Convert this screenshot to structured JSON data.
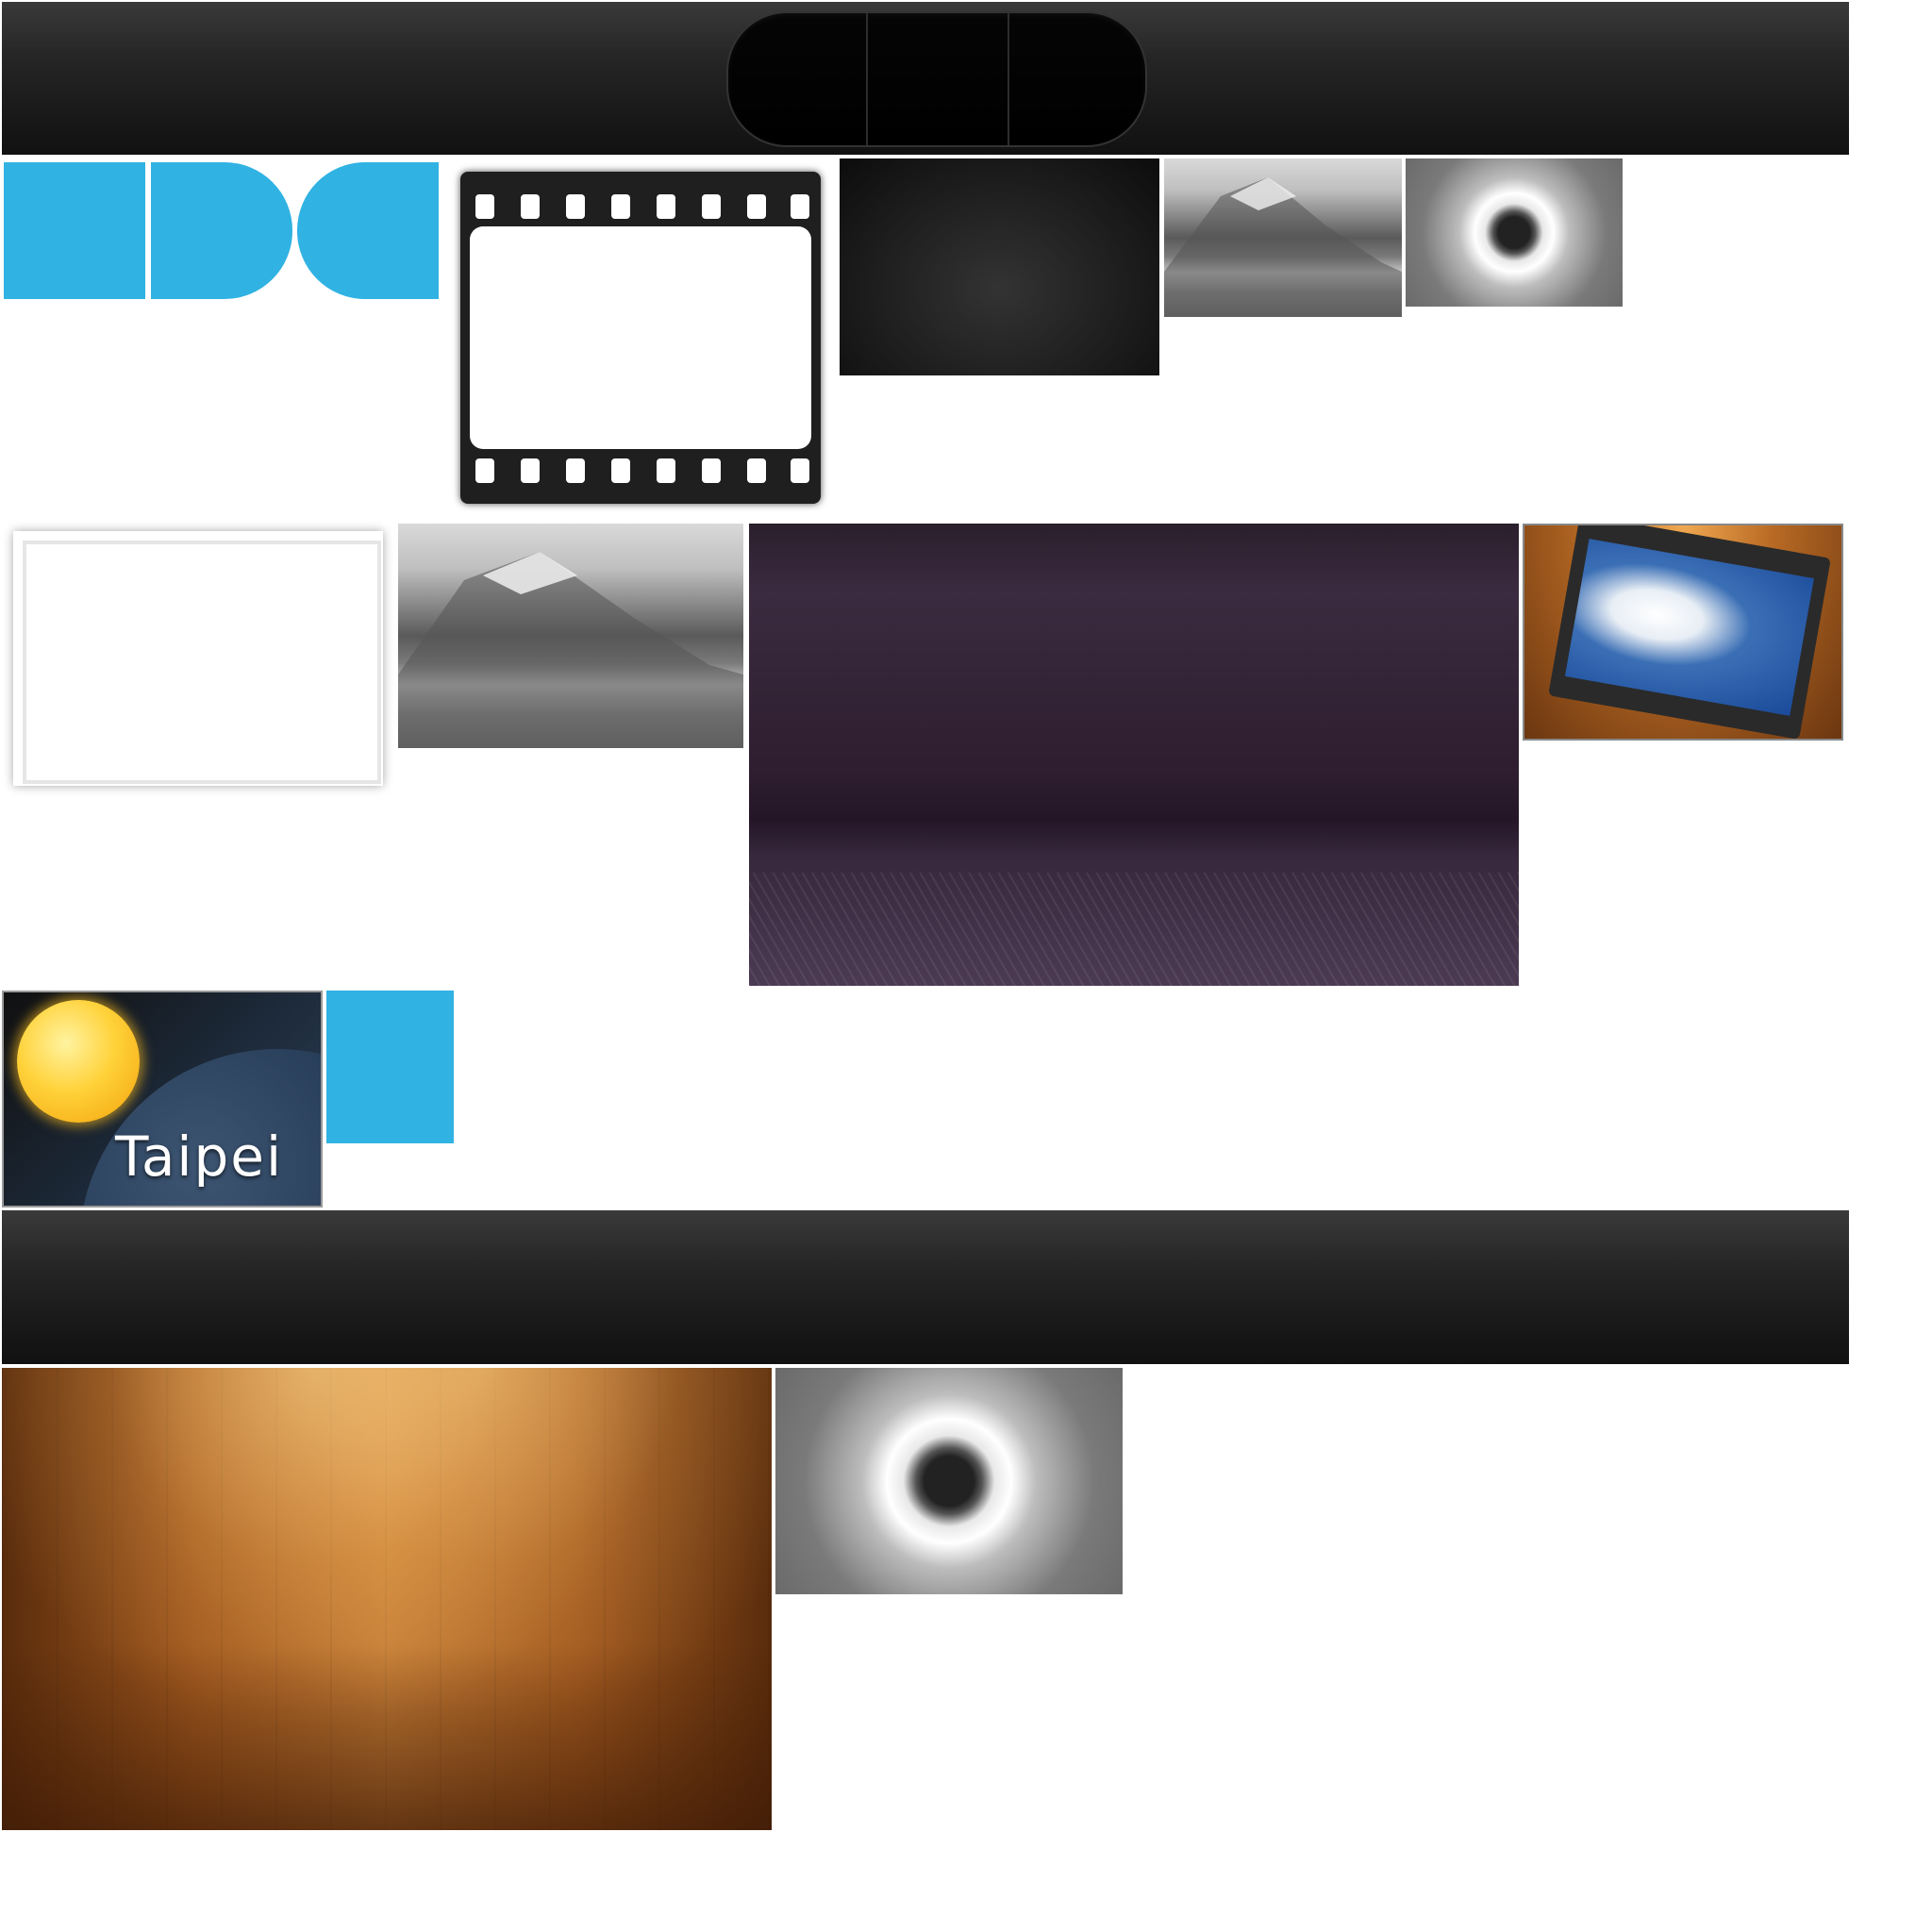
{
  "toolbars": {
    "top": {
      "segmented_control": {
        "segment_count": 3
      }
    },
    "bottom": {}
  },
  "tiles": {
    "weather": {
      "city": "Taipei"
    }
  },
  "colors": {
    "accent_blue": "#30b2e3",
    "toolbar_dark": "#1a1a1a",
    "purple_bg": "#2d1d2e",
    "wood": "#a0581e"
  },
  "icons": {
    "film_frame": "film-strip-icon",
    "photo_frame": "photo-frame-icon",
    "weather_sun": "sun-icon",
    "tab_shapes": [
      "tab-square-icon",
      "tab-right-rounded-icon",
      "tab-left-rounded-icon"
    ]
  }
}
